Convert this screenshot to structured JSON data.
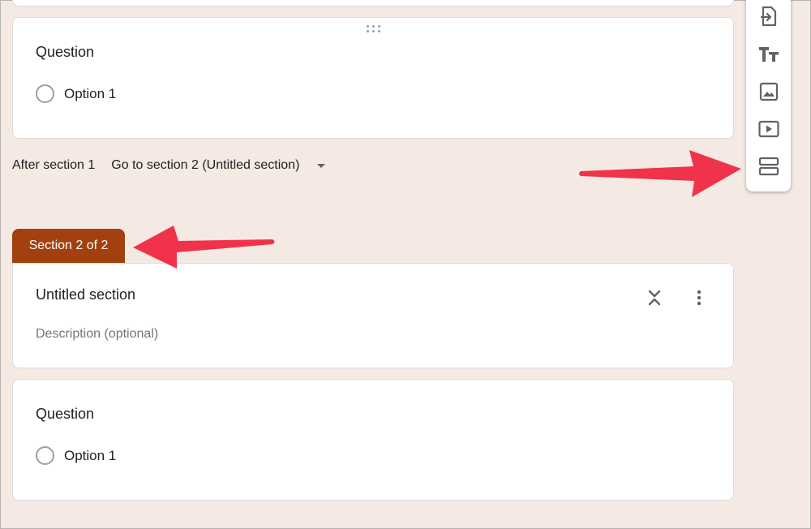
{
  "question_1": {
    "title": "Question",
    "option": "Option 1"
  },
  "navigation": {
    "after_label": "After section 1",
    "goto_value": "Go to section 2 (Untitled section)"
  },
  "section_2": {
    "tab_label": "Section 2 of 2",
    "title": "Untitled section",
    "description_placeholder": "Description (optional)"
  },
  "question_2": {
    "title": "Question",
    "option": "Option 1"
  },
  "toolbar": {
    "buttons": [
      "import-questions-icon",
      "add-title-icon",
      "add-image-icon",
      "add-video-icon",
      "add-section-icon"
    ]
  },
  "colors": {
    "page_bg": "#f5e9e4",
    "section_tab": "#a3400f",
    "annotation_arrow": "#f0324a"
  }
}
